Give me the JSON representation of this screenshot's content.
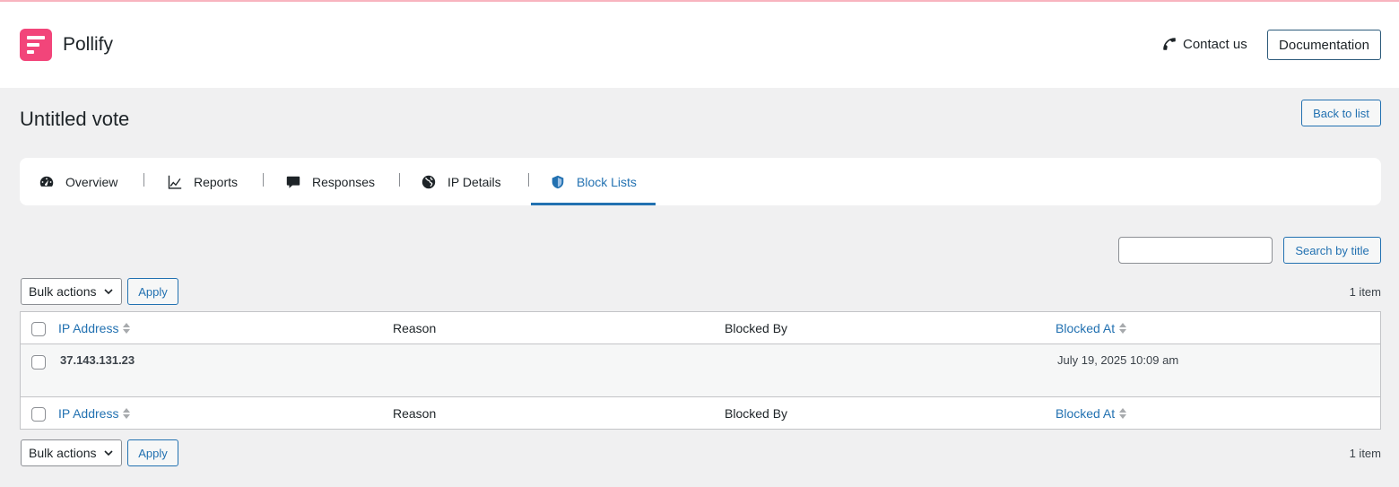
{
  "app": {
    "brand": "Pollify"
  },
  "header": {
    "contact_label": "Contact us",
    "documentation_label": "Documentation"
  },
  "page": {
    "title": "Untitled vote",
    "back_label": "Back to list"
  },
  "tabs": [
    {
      "label": "Overview",
      "icon": "dashboard-icon"
    },
    {
      "label": "Reports",
      "icon": "chart-line-icon"
    },
    {
      "label": "Responses",
      "icon": "speech-bubble-icon"
    },
    {
      "label": "IP Details",
      "icon": "globe-icon"
    },
    {
      "label": "Block Lists",
      "icon": "shield-icon",
      "active": true
    }
  ],
  "search": {
    "value": "",
    "button_label": "Search by title"
  },
  "toolbar_top": {
    "bulk_label": "Bulk actions",
    "apply_label": "Apply",
    "count": "1 item"
  },
  "toolbar_bottom": {
    "bulk_label": "Bulk actions",
    "apply_label": "Apply",
    "count": "1 item"
  },
  "table": {
    "columns": [
      "IP Address",
      "Reason",
      "Blocked By",
      "Blocked At"
    ],
    "rows": [
      {
        "ip": "37.143.131.23",
        "reason": "",
        "blocked_by": "",
        "blocked_at": "July 19, 2025 10:09 am"
      }
    ]
  },
  "colors": {
    "accent": "#2271b1",
    "brand": "#f2457a"
  }
}
